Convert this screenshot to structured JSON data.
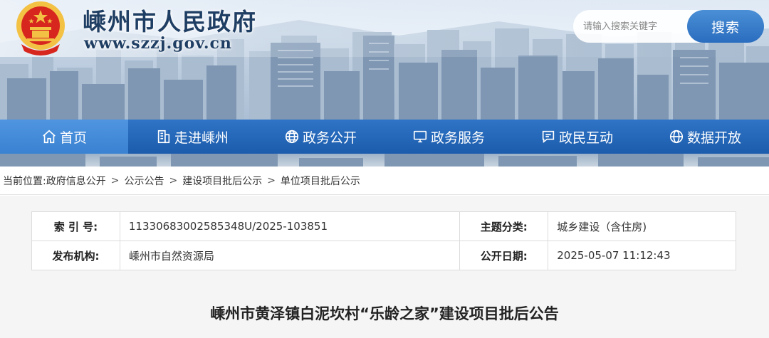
{
  "site": {
    "title": "嵊州市人民政府",
    "url": "www.szzj.gov.cn"
  },
  "search": {
    "placeholder": "请输入搜索关键字",
    "button_label": "搜索"
  },
  "nav": {
    "items": [
      {
        "label": "首页",
        "icon": "home-icon",
        "active": true
      },
      {
        "label": "走进嵊州",
        "icon": "building-icon"
      },
      {
        "label": "政务公开",
        "icon": "globe-icon"
      },
      {
        "label": "政务服务",
        "icon": "monitor-icon"
      },
      {
        "label": "政民互动",
        "icon": "chat-icon"
      },
      {
        "label": "数据开放",
        "icon": "globe-icon"
      }
    ]
  },
  "breadcrumb": {
    "prefix": "当前位置:",
    "items": [
      "政府信息公开",
      "公示公告",
      "建设项目批后公示",
      "单位项目批后公示"
    ],
    "separator": ">"
  },
  "info": {
    "index_label": "索 引 号:",
    "index_value": "11330683002585348U/2025-103851",
    "category_label": "主题分类:",
    "category_value": "城乡建设（含住房)",
    "publisher_label": "发布机构:",
    "publisher_value": "嵊州市自然资源局",
    "date_label": "公开日期:",
    "date_value": "2025-05-07 11:12:43"
  },
  "article": {
    "title": "嵊州市黄泽镇白泥坎村“乐龄之家”建设项目批后公告"
  },
  "colors": {
    "nav_blue": "#1c5cac",
    "nav_active": "#3a82d2",
    "title_navy": "#1f3e63",
    "emblem_red": "#d7261e",
    "emblem_gold": "#f3c244"
  }
}
